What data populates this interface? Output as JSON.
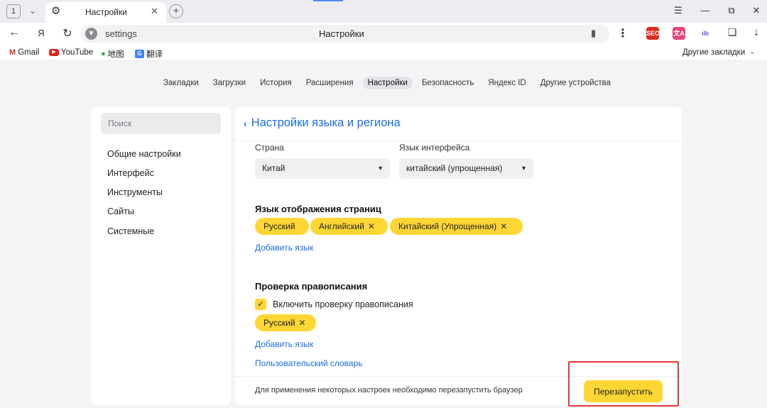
{
  "browser": {
    "tab_counter": "1",
    "tab_title": "Настройки",
    "url": "settings",
    "page_title": "Настройки",
    "extensions": [
      {
        "icon": "seo-extension-icon",
        "text": "SEO",
        "color": "#e0281b"
      },
      {
        "icon": "translate-extension-icon",
        "text": "文A",
        "color": "#e8457a"
      },
      {
        "icon": "audio-extension-icon",
        "text": "ıllı",
        "color": "#7b4bd6"
      }
    ]
  },
  "bookmarks": {
    "items": [
      {
        "label": "Gmail",
        "icon": "gmail-icon"
      },
      {
        "label": "YouTube",
        "icon": "youtube-icon"
      },
      {
        "label": "地图",
        "icon": "maps-pin-icon"
      },
      {
        "label": "翻译",
        "icon": "translate-icon"
      }
    ],
    "other": "Другие закладки"
  },
  "settings_nav": [
    {
      "label": "Закладки",
      "active": false
    },
    {
      "label": "Загрузки",
      "active": false
    },
    {
      "label": "История",
      "active": false
    },
    {
      "label": "Расширения",
      "active": false
    },
    {
      "label": "Настройки",
      "active": true
    },
    {
      "label": "Безопасность",
      "active": false
    },
    {
      "label": "Яндекс ID",
      "active": false
    },
    {
      "label": "Другие устройства",
      "active": false
    }
  ],
  "sidebar": {
    "search_placeholder": "Поиск",
    "items": [
      "Общие настройки",
      "Интерфейс",
      "Инструменты",
      "Сайты",
      "Системные"
    ]
  },
  "panel": {
    "title": "Настройки языка и региона",
    "country_label": "Страна",
    "country_value": "Китай",
    "ui_lang_label": "Язык интерфейса",
    "ui_lang_value": "китайский (упрощенная)",
    "display_lang_title": "Язык отображения страниц",
    "display_langs": [
      "Русский",
      "Английский",
      "Китайский (Упрощенная)"
    ],
    "add_language": "Добавить язык",
    "spellcheck_title": "Проверка правописания",
    "spellcheck_checkbox": "Включить проверку правописания",
    "spellcheck_checked": true,
    "spellcheck_langs": [
      "Русский"
    ],
    "spellcheck_add_language": "Добавить язык",
    "user_dictionary": "Пользовательский словарь",
    "restart_note": "Для применения некоторых настроек необходимо перезапустить браузер",
    "restart_button": "Перезапустить"
  },
  "colors": {
    "accent": "#ffd633",
    "link": "#1a6ee6",
    "highlight": "#e53935"
  }
}
